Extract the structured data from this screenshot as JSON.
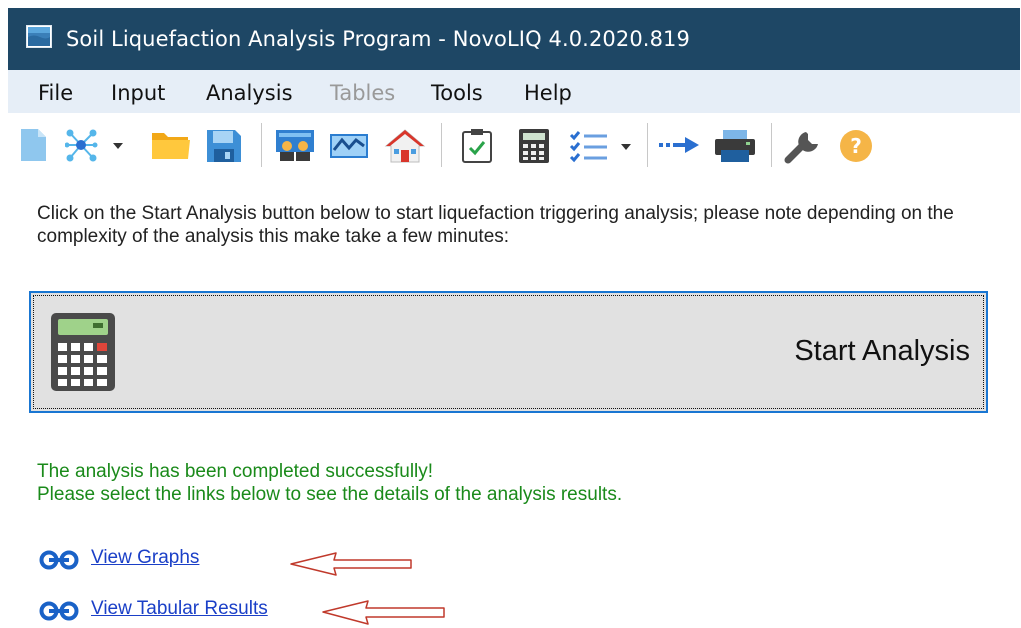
{
  "window": {
    "title": "Soil Liquefaction Analysis Program - NovoLIQ 4.0.2020.819"
  },
  "menu": {
    "items": [
      {
        "label": "File",
        "enabled": true
      },
      {
        "label": "Input",
        "enabled": true
      },
      {
        "label": "Analysis",
        "enabled": true
      },
      {
        "label": "Tables",
        "enabled": false
      },
      {
        "label": "Tools",
        "enabled": true
      },
      {
        "label": "Help",
        "enabled": true
      }
    ]
  },
  "toolbar": {
    "icons": [
      "new-file-icon",
      "network-icon",
      "open-folder-icon",
      "save-icon",
      "site-data-icon",
      "graph-icon",
      "home-icon",
      "checklist-icon",
      "calculator-icon",
      "list-icon",
      "export-arrow-icon",
      "print-icon",
      "wrench-icon",
      "help-icon"
    ]
  },
  "main": {
    "intro": "Click on the Start Analysis button below to start liquefaction triggering analysis; please note depending on the complexity of the analysis this make take a few minutes:",
    "start_button_label": "Start Analysis",
    "success_line1": "The analysis has been completed successfully!",
    "success_line2": "Please select the links below to see the details of the analysis results.",
    "links": [
      {
        "label": "View Graphs"
      },
      {
        "label": "View Tabular Results"
      }
    ]
  },
  "colors": {
    "titlebar": "#1e4765",
    "menubar": "#e6eef7",
    "success_text": "#1a8a1a",
    "link_text": "#1a3fc7",
    "start_border": "#1976d2",
    "annotation_arrow": "#c0392b"
  }
}
